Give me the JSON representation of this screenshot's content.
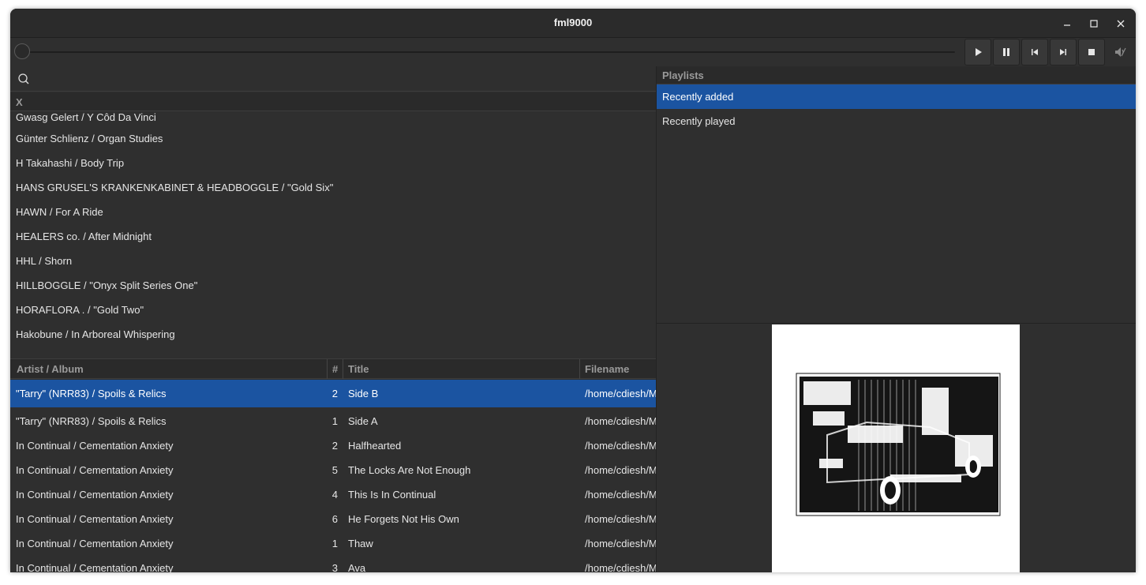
{
  "window": {
    "title": "fml9000"
  },
  "player": {
    "progress": 0,
    "buttons": [
      "play",
      "pause",
      "previous",
      "next",
      "stop",
      "mute"
    ]
  },
  "search": {
    "value": "",
    "placeholder": ""
  },
  "album_list": {
    "header": "X",
    "items": [
      "Gwasg Gelert / Y Côd Da Vinci",
      "Günter Schlienz / Organ Studies",
      "H Takahashi / Body Trip",
      "HANS GRUSEL'S KRANKENKABINET & HEADBOGGLE / \"Gold Six\"",
      "HAWN / For A Ride",
      "HEALERS co. / After Midnight",
      "HHL / Shorn",
      "HILLBOGGLE  / \"Onyx Split Series One\"",
      "HORAFLORA . / \"Gold Two\"",
      "Hakobune / In Arboreal Whispering"
    ]
  },
  "tracks": {
    "columns": {
      "artist": "Artist / Album",
      "num": "#",
      "title": "Title",
      "file": "Filename"
    },
    "rows": [
      {
        "artist": "\"Tarry\" (NRR83) / Spoils & Relics",
        "num": "2",
        "title": "Side B",
        "file": "/home/cdiesh/M"
      },
      {
        "artist": "\"Tarry\" (NRR83) / Spoils & Relics",
        "num": "1",
        "title": "Side A",
        "file": "/home/cdiesh/M"
      },
      {
        "artist": "In Continual / Cementation Anxiety",
        "num": "2",
        "title": "Halfhearted",
        "file": "/home/cdiesh/M"
      },
      {
        "artist": "In Continual / Cementation Anxiety",
        "num": "5",
        "title": "The Locks Are Not Enough",
        "file": "/home/cdiesh/M"
      },
      {
        "artist": "In Continual / Cementation Anxiety",
        "num": "4",
        "title": "This Is In Continual",
        "file": "/home/cdiesh/M"
      },
      {
        "artist": "In Continual / Cementation Anxiety",
        "num": "6",
        "title": "He Forgets Not His Own",
        "file": "/home/cdiesh/M"
      },
      {
        "artist": "In Continual / Cementation Anxiety",
        "num": "1",
        "title": "Thaw",
        "file": "/home/cdiesh/M"
      },
      {
        "artist": "In Continual / Cementation Anxiety",
        "num": "3",
        "title": "Ava",
        "file": "/home/cdiesh/M"
      }
    ]
  },
  "playlists": {
    "header": "Playlists",
    "items": [
      "Recently added",
      "Recently played"
    ]
  },
  "colors": {
    "selection": "#1b54a1",
    "background": "#2f2f2f"
  }
}
